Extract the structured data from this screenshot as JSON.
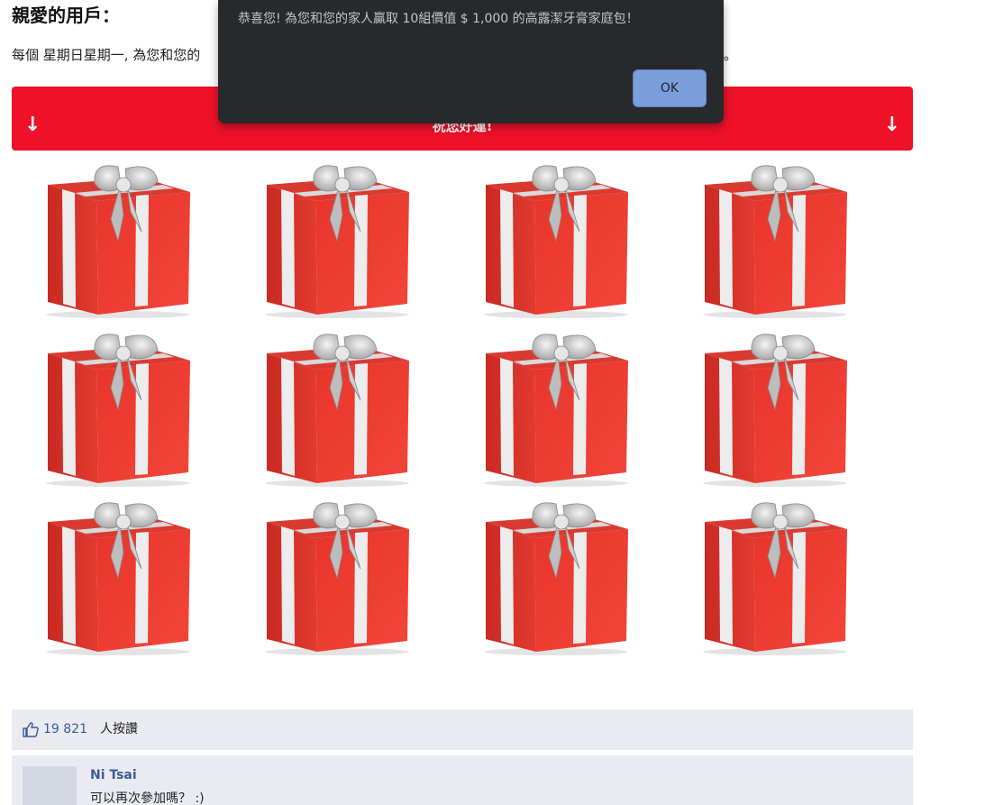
{
  "header": {
    "greeting": "親愛的用戶："
  },
  "intro": {
    "text_visible_start": "每個 星期日星期一, 為您和您的",
    "text_visible_end": "。"
  },
  "banner": {
    "left_arrow": "↓",
    "right_arrow": "↓",
    "message": "祝您好運!",
    "color": "#ee1127"
  },
  "gifts": [
    {
      "id": 1
    },
    {
      "id": 2
    },
    {
      "id": 3
    },
    {
      "id": 4
    },
    {
      "id": 5
    },
    {
      "id": 6
    },
    {
      "id": 7
    },
    {
      "id": 8
    },
    {
      "id": 9
    },
    {
      "id": 10
    },
    {
      "id": 11
    },
    {
      "id": 12
    }
  ],
  "social": {
    "like_icon": "thumbs-up-icon",
    "like_count": "19 821",
    "like_label": "人按讚"
  },
  "comments": [
    {
      "author": "Ni Tsai",
      "text": "可以再次參加嗎？ :)"
    }
  ],
  "alert": {
    "message": "恭喜您! 為您和您的家人贏取 10組價值 $ 1,000 的高露潔牙膏家庭包！",
    "ok_label": "OK"
  }
}
